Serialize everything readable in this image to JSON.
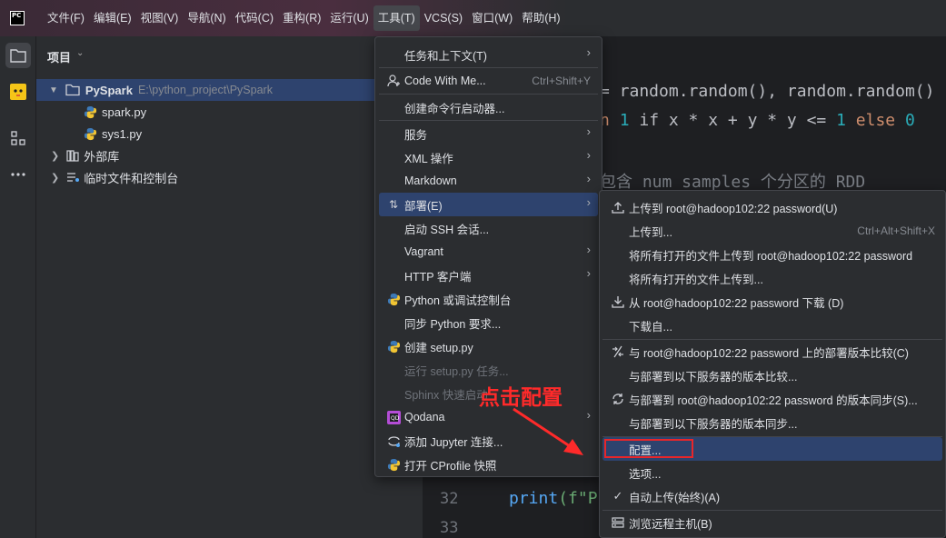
{
  "app": {
    "logo_text": "PC"
  },
  "menubar": {
    "items": [
      "文件(F)",
      "编辑(E)",
      "视图(V)",
      "导航(N)",
      "代码(C)",
      "重构(R)",
      "运行(U)",
      "工具(T)",
      "VCS(S)",
      "窗口(W)",
      "帮助(H)"
    ],
    "active_index": 7
  },
  "toolstrip": {
    "icons": [
      "folder-icon",
      "plugin-avatar-icon",
      "structure-icon",
      "more-icon"
    ]
  },
  "project_panel": {
    "title": "项目",
    "tree": [
      {
        "label": "PySpark",
        "detail": "E:\\python_project\\PySpark",
        "expanded": true
      },
      {
        "label": "spark.py"
      },
      {
        "label": "sys1.py"
      },
      {
        "label": "外部库"
      },
      {
        "label": "临时文件和控制台"
      }
    ]
  },
  "editor": {
    "line1": "= random.random(), random.random()",
    "line2_prefix": "n ",
    "line2_num1": "1",
    "line2_mid": " if x * x + y * y <= ",
    "line2_num2": "1",
    "line2_else": " else ",
    "line2_num3": "0",
    "comment": "包含 num_samples 个分区的 RDD",
    "ln32": "32",
    "ln33": "33",
    "print_fn": "print",
    "print_rest": "(f\"P"
  },
  "tools_menu": {
    "items": [
      {
        "label": "任务和上下文(T)",
        "submenu": true
      },
      {
        "label": "Code With Me...",
        "shortcut": "Ctrl+Shift+Y",
        "icon": "person-icon"
      },
      {
        "label": "创建命令行启动器..."
      },
      {
        "label": "服务",
        "submenu": true
      },
      {
        "label": "XML 操作",
        "submenu": true
      },
      {
        "label": "Markdown",
        "submenu": true
      },
      {
        "label": "部署(E)",
        "submenu": true,
        "icon": "deploy-icon",
        "highlighted": true
      },
      {
        "label": "启动 SSH 会话..."
      },
      {
        "label": "Vagrant",
        "submenu": true
      },
      {
        "label": "HTTP 客户端",
        "submenu": true
      },
      {
        "label": "Python 或调试控制台",
        "icon": "python-icon"
      },
      {
        "label": "同步 Python 要求..."
      },
      {
        "label": "创建 setup.py",
        "icon": "python-icon"
      },
      {
        "label": "运行 setup.py 任务...",
        "disabled": true
      },
      {
        "label": "Sphinx 快速启动",
        "disabled": true
      },
      {
        "label": "Qodana",
        "submenu": true,
        "icon": "qodana-icon"
      },
      {
        "label": "添加 Jupyter 连接...",
        "icon": "jupyter-icon"
      },
      {
        "label": "打开 CProfile 快照",
        "icon": "python-icon"
      }
    ]
  },
  "deploy_menu": {
    "items": [
      {
        "label": "上传到 root@hadoop102:22 password(U)",
        "icon": "upload-icon"
      },
      {
        "label": "上传到...",
        "shortcut": "Ctrl+Alt+Shift+X"
      },
      {
        "label": "将所有打开的文件上传到 root@hadoop102:22 password"
      },
      {
        "label": "将所有打开的文件上传到..."
      },
      {
        "label": "从 root@hadoop102:22 password 下载 (D)",
        "icon": "download-icon"
      },
      {
        "label": "下载自..."
      },
      {
        "label": "与 root@hadoop102:22 password 上的部署版本比较(C)",
        "icon": "compare-icon"
      },
      {
        "label": "与部署到以下服务器的版本比较..."
      },
      {
        "label": "与部署到 root@hadoop102:22 password 的版本同步(S)...",
        "icon": "sync-icon"
      },
      {
        "label": "与部署到以下服务器的版本同步..."
      },
      {
        "label": "配置...",
        "highlighted": true
      },
      {
        "label": "选项..."
      },
      {
        "label": "自动上传(始终)(A)",
        "icon": "check-icon",
        "checked": true
      },
      {
        "label": "浏览远程主机(B)",
        "icon": "remote-host-icon"
      }
    ]
  },
  "annotation": {
    "text": "点击配置",
    "color": "#ff2a2a"
  },
  "colors": {
    "highlight": "#2e436e",
    "menu_bg": "#2b2d30",
    "editor_bg": "#1e1f22"
  }
}
